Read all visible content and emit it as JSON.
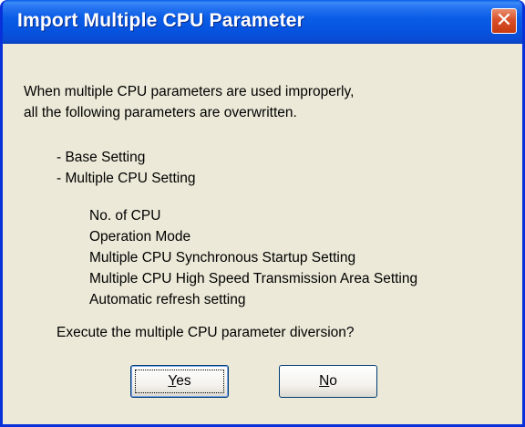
{
  "window": {
    "title": "Import Multiple CPU Parameter",
    "close_symbol": "✕"
  },
  "message": {
    "lines": [
      "When multiple CPU parameters are used improperly,",
      "all the following parameters are overwritten."
    ],
    "top_items": [
      "- Base Setting",
      "- Multiple CPU Setting"
    ],
    "sub_items": [
      "No. of CPU",
      "Operation Mode",
      "Multiple CPU Synchronous Startup Setting",
      "Multiple CPU High Speed Transmission Area Setting",
      "Automatic refresh setting"
    ],
    "question": "Execute the multiple CPU parameter diversion?"
  },
  "buttons": {
    "yes_mnemonic": "Y",
    "yes_rest": "es",
    "no_mnemonic": "N",
    "no_rest": "o"
  },
  "icons": {
    "close": "close-icon"
  },
  "colors": {
    "titlebar": "#0a5de6",
    "close_button": "#d9502a",
    "client_background": "#ece9d8",
    "frame": "#0831d9"
  }
}
